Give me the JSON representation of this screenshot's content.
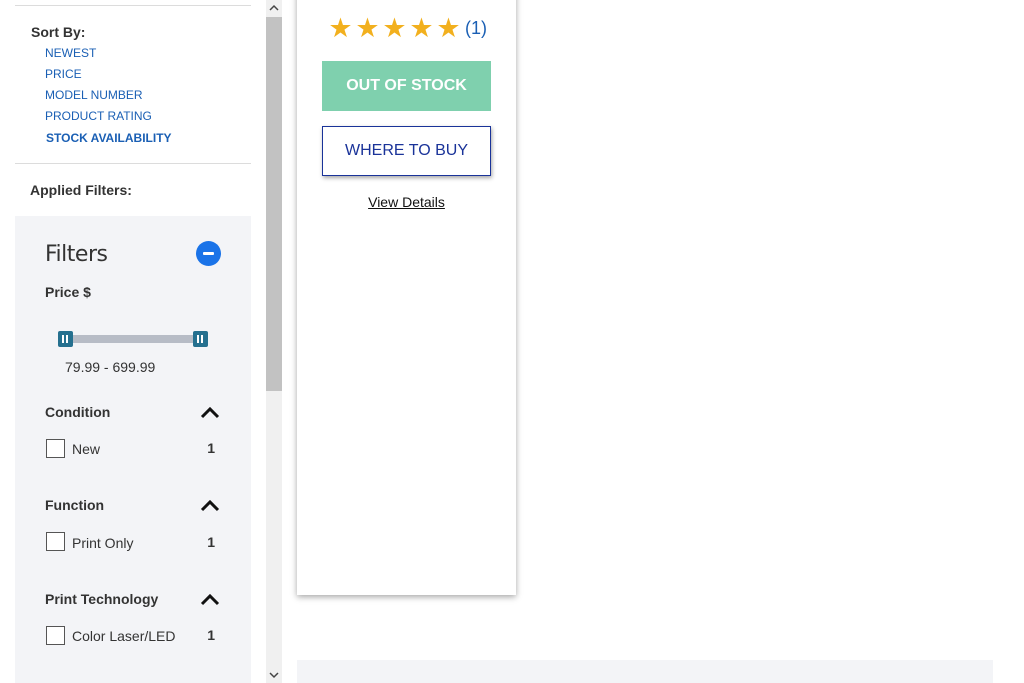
{
  "sort": {
    "title": "Sort By:",
    "options": [
      "NEWEST",
      "PRICE",
      "MODEL NUMBER",
      "PRODUCT RATING",
      "STOCK AVAILABILITY"
    ],
    "active_index": 4
  },
  "applied_filters": {
    "title": "Applied Filters:"
  },
  "filters": {
    "heading": "Filters",
    "collapse_icon": "minus-circle-icon",
    "price": {
      "label": "Price $",
      "range_text": "79.99 - 699.99",
      "min": 79.99,
      "max": 699.99,
      "selected_min_fraction": 0.0,
      "selected_max_fraction": 1.0
    },
    "facets": [
      {
        "title": "Condition",
        "chevron_icon": "chevron-up-icon",
        "option": "New",
        "count": "1"
      },
      {
        "title": "Function",
        "chevron_icon": "chevron-up-icon",
        "option": "Print Only",
        "count": "1"
      },
      {
        "title": "Print Technology",
        "chevron_icon": "chevron-up-icon",
        "option": "Color Laser/LED",
        "count": "1"
      }
    ]
  },
  "product": {
    "rating_stars": 5,
    "review_count": "(1)",
    "out_of_stock_label": "OUT OF STOCK",
    "where_to_buy_label": "WHERE TO BUY",
    "view_details_label": "View Details"
  },
  "colors": {
    "link_blue": "#1a5fb4",
    "star_gold": "#f2b01e",
    "out_of_stock_green": "#7fd0ae",
    "where_to_buy_navy": "#1a3399",
    "filter_panel_bg": "#f3f4f7",
    "slider_handle": "#25708f"
  }
}
